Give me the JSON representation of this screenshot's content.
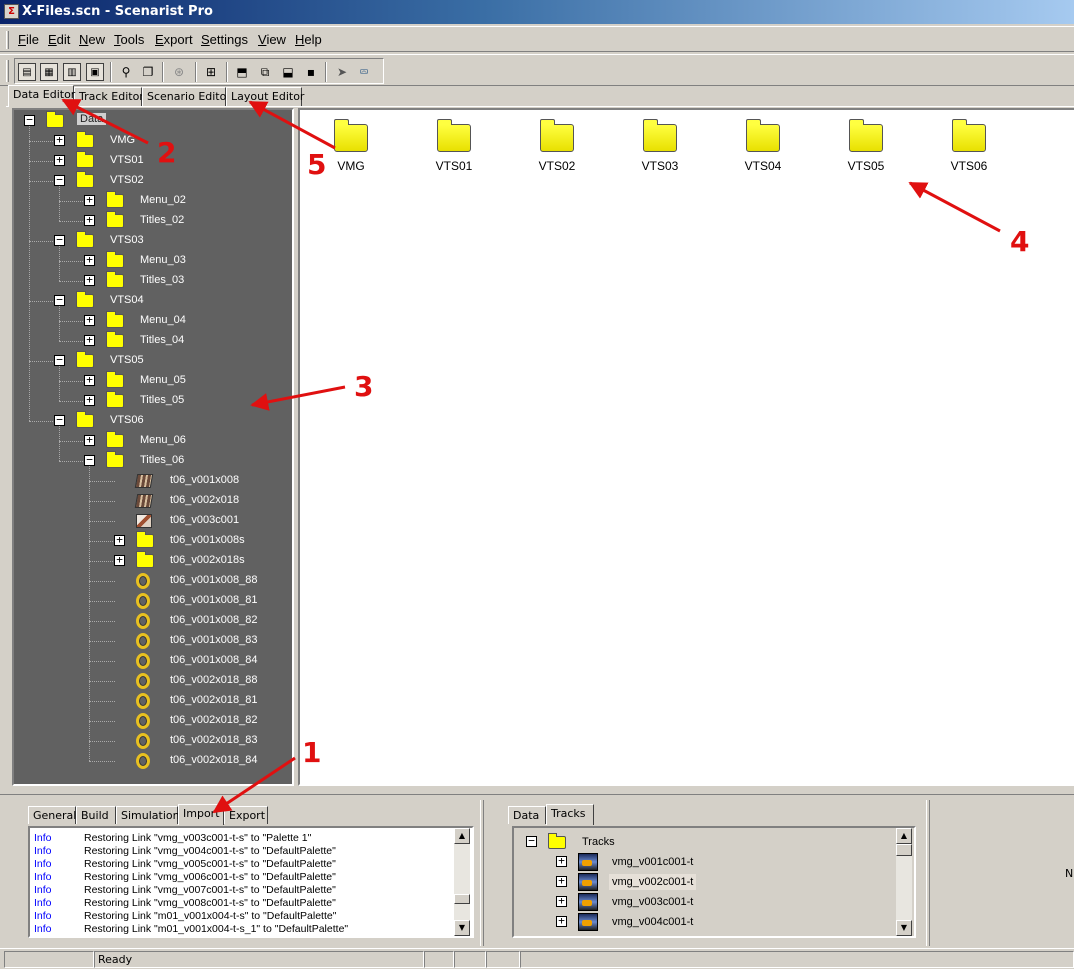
{
  "window": {
    "title": "X-Files.scn - Scenarist Pro",
    "icon": "scenarist-app-icon",
    "icon_glyph": "Σ"
  },
  "menu": [
    "File",
    "Edit",
    "New",
    "Tools",
    "Export",
    "Settings",
    "View",
    "Help"
  ],
  "toolbar": {
    "buttons": [
      "view-data-icon",
      "view-track-icon",
      "view-scenario-icon",
      "view-layout-icon",
      "search-icon",
      "open-folder-icon",
      "globe-icon",
      "new-folder-icon",
      "import-icon",
      "copy-icon",
      "export-icon",
      "disk-icon",
      "pointer-icon",
      "build-icon"
    ],
    "glyphs": {
      "a": "▤",
      "b": "▦",
      "c": "▥",
      "d": "▣",
      "e": "⚲",
      "f": "❐",
      "g": "⊛",
      "h": "⊞",
      "i": "⬒",
      "j": "⧉",
      "k": "⬓",
      "l": "▪",
      "m": "➤",
      "n": "⮹"
    }
  },
  "main_tabs": [
    "Data Editor",
    "Track Editor",
    "Scenario Editor",
    "Layout Editor"
  ],
  "tree": {
    "root": "Data",
    "expanded_glyph": "−",
    "collapsed_glyph": "+",
    "items": [
      {
        "label": "Data",
        "icon": "folder-icon",
        "expand": "−"
      },
      {
        "label": "VMG",
        "icon": "folder-icon",
        "expand": "+"
      },
      {
        "label": "VTS01",
        "icon": "folder-icon",
        "expand": "+"
      },
      {
        "label": "VTS02",
        "icon": "folder-icon",
        "expand": "−"
      },
      {
        "label": "Menu_02",
        "icon": "folder-icon",
        "expand": "+"
      },
      {
        "label": "Titles_02",
        "icon": "folder-icon",
        "expand": "+"
      },
      {
        "label": "VTS03",
        "icon": "folder-icon",
        "expand": "−"
      },
      {
        "label": "Menu_03",
        "icon": "folder-icon",
        "expand": "+"
      },
      {
        "label": "Titles_03",
        "icon": "folder-icon",
        "expand": "+"
      },
      {
        "label": "VTS04",
        "icon": "folder-icon",
        "expand": "−"
      },
      {
        "label": "Menu_04",
        "icon": "folder-icon",
        "expand": "+"
      },
      {
        "label": "Titles_04",
        "icon": "folder-icon",
        "expand": "+"
      },
      {
        "label": "VTS05",
        "icon": "folder-icon",
        "expand": "−"
      },
      {
        "label": "Menu_05",
        "icon": "folder-icon",
        "expand": "+"
      },
      {
        "label": "Titles_05",
        "icon": "folder-icon",
        "expand": "+"
      },
      {
        "label": "VTS06",
        "icon": "folder-icon",
        "expand": "−"
      },
      {
        "label": "Menu_06",
        "icon": "folder-icon",
        "expand": "+"
      },
      {
        "label": "Titles_06",
        "icon": "folder-icon",
        "expand": "−"
      },
      {
        "label": "t06_v001x008",
        "icon": "video-clip-icon",
        "expand": ""
      },
      {
        "label": "t06_v002x018",
        "icon": "video-clip-icon",
        "expand": ""
      },
      {
        "label": "t06_v003c001",
        "icon": "image-asset-icon",
        "expand": ""
      },
      {
        "label": "t06_v001x008s",
        "icon": "folder-icon",
        "expand": "+"
      },
      {
        "label": "t06_v002x018s",
        "icon": "folder-icon",
        "expand": "+"
      },
      {
        "label": "t06_v001x008_88",
        "icon": "audio-asset-icon",
        "expand": ""
      },
      {
        "label": "t06_v001x008_81",
        "icon": "audio-asset-icon",
        "expand": ""
      },
      {
        "label": "t06_v001x008_82",
        "icon": "audio-asset-icon",
        "expand": ""
      },
      {
        "label": "t06_v001x008_83",
        "icon": "audio-asset-icon",
        "expand": ""
      },
      {
        "label": "t06_v001x008_84",
        "icon": "audio-asset-icon",
        "expand": ""
      },
      {
        "label": "t06_v002x018_88",
        "icon": "audio-asset-icon",
        "expand": ""
      },
      {
        "label": "t06_v002x018_81",
        "icon": "audio-asset-icon",
        "expand": ""
      },
      {
        "label": "t06_v002x018_82",
        "icon": "audio-asset-icon",
        "expand": ""
      },
      {
        "label": "t06_v002x018_83",
        "icon": "audio-asset-icon",
        "expand": ""
      },
      {
        "label": "t06_v002x018_84",
        "icon": "audio-asset-icon",
        "expand": ""
      }
    ]
  },
  "folder_view": [
    "VMG",
    "VTS01",
    "VTS02",
    "VTS03",
    "VTS04",
    "VTS05",
    "VTS06"
  ],
  "output_tabs": [
    "General",
    "Build",
    "Simulation",
    "Import",
    "Export"
  ],
  "log": [
    {
      "level": "Info",
      "message": "Restoring Link \"vmg_v003c001-t-s\" to \"Palette 1\""
    },
    {
      "level": "Info",
      "message": "Restoring Link \"vmg_v004c001-t-s\" to \"DefaultPalette\""
    },
    {
      "level": "Info",
      "message": "Restoring Link \"vmg_v005c001-t-s\" to \"DefaultPalette\""
    },
    {
      "level": "Info",
      "message": "Restoring Link \"vmg_v006c001-t-s\" to \"DefaultPalette\""
    },
    {
      "level": "Info",
      "message": "Restoring Link \"vmg_v007c001-t-s\" to \"DefaultPalette\""
    },
    {
      "level": "Info",
      "message": "Restoring Link \"vmg_v008c001-t-s\" to \"DefaultPalette\""
    },
    {
      "level": "Info",
      "message": "Restoring Link \"m01_v001x004-t-s\" to \"DefaultPalette\""
    },
    {
      "level": "Info",
      "message": "Restoring Link \"m01_v001x004-t-s_1\" to \"DefaultPalette\""
    }
  ],
  "side_tabs": [
    "Data",
    "Tracks"
  ],
  "tracks": {
    "root": "Tracks",
    "items": [
      "vmg_v001c001-t",
      "vmg_v002c001-t",
      "vmg_v003c001-t",
      "vmg_v004c001-t"
    ]
  },
  "right_pane_fragment": "N",
  "scroll_glyphs": {
    "up": "▲",
    "down": "▼"
  },
  "status": {
    "text": "Ready"
  },
  "annotations": [
    "1",
    "2",
    "3",
    "4",
    "5"
  ],
  "colors": {
    "annotation": "#e01010",
    "tree_bg": "#616161",
    "folder": "#ffff00",
    "log_level": "#0000ff"
  }
}
